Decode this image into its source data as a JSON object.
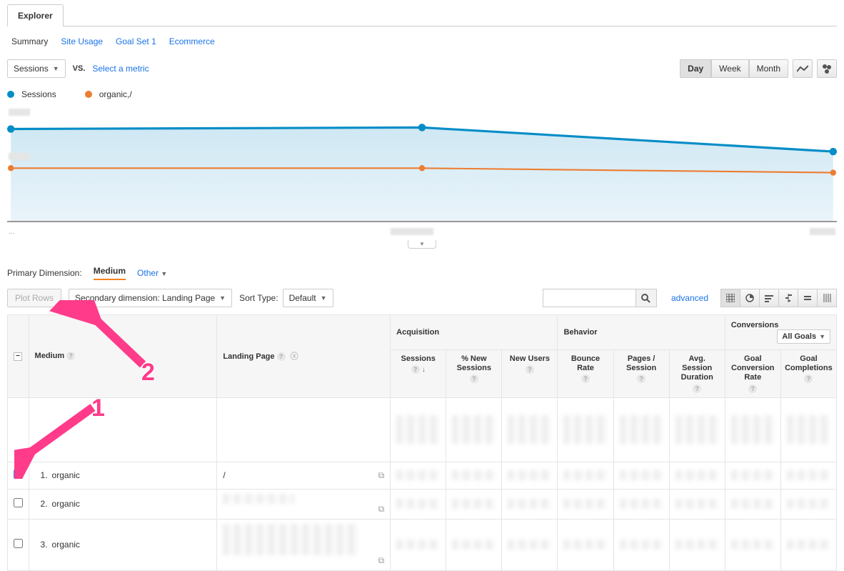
{
  "tabs": {
    "explorer": "Explorer"
  },
  "subtabs": {
    "summary": "Summary",
    "site_usage": "Site Usage",
    "goal_set_1": "Goal Set 1",
    "ecommerce": "Ecommerce"
  },
  "metric_bar": {
    "sessions_select": "Sessions",
    "vs": "VS.",
    "select_metric": "Select a metric",
    "period": {
      "day": "Day",
      "week": "Week",
      "month": "Month"
    }
  },
  "legend": {
    "sessions": "Sessions",
    "organic": "organic,/"
  },
  "xaxis": {
    "left": "...",
    "mid": "",
    "right": ""
  },
  "chart_data": {
    "type": "line",
    "x": [
      0,
      1,
      2
    ],
    "series": [
      {
        "name": "Sessions",
        "values": [
          100,
          102,
          78
        ],
        "color": "#058dc7"
      },
      {
        "name": "organic,/",
        "values": [
          58,
          58,
          54
        ],
        "color": "#ed7d31"
      }
    ],
    "ylim": [
      0,
      120
    ]
  },
  "primary_dimension": {
    "label": "Primary Dimension:",
    "medium": "Medium",
    "other": "Other"
  },
  "toolbar": {
    "plot_rows": "Plot Rows",
    "secondary_dim": "Secondary dimension: Landing Page",
    "sort_type": "Sort Type:",
    "sort_default": "Default",
    "advanced": "advanced"
  },
  "table": {
    "groups": {
      "acquisition": "Acquisition",
      "behavior": "Behavior",
      "conversions": "Conversions",
      "all_goals": "All Goals"
    },
    "cols": {
      "medium": "Medium",
      "landing_page": "Landing Page",
      "sessions": "Sessions",
      "pct_new": "% New Sessions",
      "new_users": "New Users",
      "bounce": "Bounce Rate",
      "pps": "Pages / Session",
      "avg_dur": "Avg. Session Duration",
      "gcr": "Goal Conversion Rate",
      "gcomp": "Goal Completions"
    },
    "rows": [
      {
        "n": "1.",
        "medium": "organic",
        "landing": "/",
        "checked": true
      },
      {
        "n": "2.",
        "medium": "organic",
        "landing": "",
        "checked": false
      },
      {
        "n": "3.",
        "medium": "organic",
        "landing": "",
        "checked": false
      }
    ]
  },
  "annotations": {
    "one": "1",
    "two": "2"
  }
}
